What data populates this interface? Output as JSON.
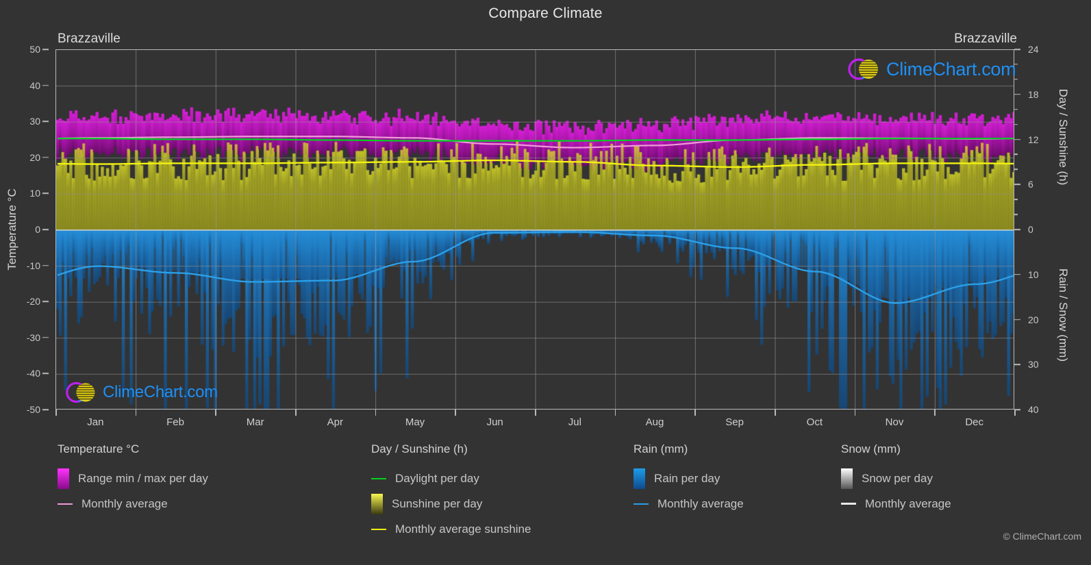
{
  "header": {
    "title": "Compare Climate",
    "city_left": "Brazzaville",
    "city_right": "Brazzaville"
  },
  "branding": {
    "logo_text": "ClimeChart.com",
    "copyright": "© ClimeChart.com"
  },
  "axes": {
    "left_title": "Temperature °C",
    "right_title_top": "Day / Sunshine (h)",
    "right_title_bottom": "Rain / Snow (mm)",
    "left_ticks": [
      50,
      40,
      30,
      20,
      10,
      0,
      -10,
      -20,
      -30,
      -40,
      -50
    ],
    "right_ticks_top": [
      24,
      18,
      12,
      6,
      0
    ],
    "right_ticks_bottom": [
      10,
      20,
      30,
      40
    ],
    "x_ticks": [
      "Jan",
      "Feb",
      "Mar",
      "Apr",
      "May",
      "Jun",
      "Jul",
      "Aug",
      "Sep",
      "Oct",
      "Nov",
      "Dec"
    ]
  },
  "legend": {
    "columns": [
      {
        "heading": "Temperature °C",
        "items": [
          {
            "label": "Range min / max per day",
            "type": "gradient",
            "colors": [
              "#8a0a8a",
              "#ff33ff"
            ]
          },
          {
            "label": "Monthly average",
            "type": "line",
            "color": "#ee9ad8"
          }
        ]
      },
      {
        "heading": "Day / Sunshine (h)",
        "items": [
          {
            "label": "Daylight per day",
            "type": "line",
            "color": "#00d21e"
          },
          {
            "label": "Sunshine per day",
            "type": "gradient",
            "colors": [
              "#3d3a11",
              "#f7f750"
            ]
          },
          {
            "label": "Monthly average sunshine",
            "type": "line",
            "color": "#f2f211"
          }
        ]
      },
      {
        "heading": "Rain (mm)",
        "items": [
          {
            "label": "Rain per day",
            "type": "gradient",
            "colors": [
              "#0f4a8f",
              "#1e9de8"
            ]
          },
          {
            "label": "Monthly average",
            "type": "line",
            "color": "#2a9fe8"
          }
        ]
      },
      {
        "heading": "Snow (mm)",
        "items": [
          {
            "label": "Snow per day",
            "type": "gradient",
            "colors": [
              "#555555",
              "#ffffff"
            ]
          },
          {
            "label": "Monthly average",
            "type": "line",
            "color": "#e8e8e8"
          }
        ]
      }
    ]
  },
  "colors": {
    "background": "#333333",
    "grid": "#9a9a9a",
    "axis": "#b9b9b9",
    "temp_range": "#b318b3",
    "temp_avg_line": "#ee9ad8",
    "daylight_line": "#00d21e",
    "sunshine_fill": "#9a9a24",
    "sunshine_line": "#f2f211",
    "rain_fill": "#1f7fc4",
    "rain_avg_line": "#2a9fe8"
  },
  "chart_data": {
    "type": "area",
    "title": "Compare Climate",
    "subtitle": "Brazzaville",
    "xlabel": "",
    "ylabel": "Temperature °C",
    "ylim": [
      -50,
      50
    ],
    "y2lim_top_hours": [
      0,
      24
    ],
    "y2lim_bottom_mm": [
      0,
      40
    ],
    "grid": true,
    "legend_position": "bottom",
    "categories": [
      "Jan",
      "Feb",
      "Mar",
      "Apr",
      "May",
      "Jun",
      "Jul",
      "Aug",
      "Sep",
      "Oct",
      "Nov",
      "Dec"
    ],
    "series": [
      {
        "name": "Monthly average temperature (°C)",
        "unit": "°C",
        "axis": "left",
        "color": "#ee9ad8",
        "values": [
          25.6,
          25.8,
          26.0,
          26.0,
          25.6,
          23.9,
          22.9,
          23.5,
          25.0,
          25.6,
          25.5,
          25.3
        ]
      },
      {
        "name": "Daily maximum temperature (°C)",
        "unit": "°C",
        "axis": "left",
        "color": "#ff33ff",
        "values": [
          31.0,
          31.4,
          31.6,
          31.5,
          31.0,
          29.2,
          28.2,
          29.0,
          30.6,
          31.0,
          30.8,
          30.6
        ]
      },
      {
        "name": "Daily minimum temperature (°C)",
        "unit": "°C",
        "axis": "left",
        "color": "#8a0a8a",
        "values": [
          21.5,
          21.7,
          21.8,
          21.9,
          21.6,
          19.5,
          18.4,
          18.9,
          20.6,
          21.3,
          21.4,
          21.3
        ]
      },
      {
        "name": "Daylight per day (h)",
        "unit": "h",
        "axis": "right_top",
        "color": "#00d21e",
        "values": [
          12.2,
          12.1,
          12.1,
          12.0,
          11.9,
          11.9,
          11.9,
          12.0,
          12.0,
          12.1,
          12.2,
          12.2
        ]
      },
      {
        "name": "Monthly average sunshine (h)",
        "unit": "h",
        "axis": "right_top",
        "color": "#f2f211",
        "values": [
          8.8,
          8.9,
          8.9,
          9.0,
          9.1,
          9.3,
          9.1,
          8.6,
          8.4,
          8.7,
          8.9,
          8.9
        ]
      },
      {
        "name": "Monthly average rain (mm)",
        "unit": "mm",
        "axis": "right_bottom",
        "color": "#2a9fe8",
        "values": [
          8.0,
          9.5,
          11.5,
          11.2,
          7.0,
          0.6,
          0.4,
          1.2,
          4.0,
          9.2,
          16.2,
          12.0
        ]
      }
    ],
    "notes": "Daily values are drawn as dense vertical bars: magenta = daily min/max temperature range, yellow = sunshine hours per day, blue = rain per day."
  }
}
